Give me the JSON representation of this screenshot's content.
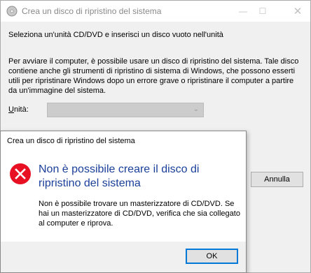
{
  "main_window": {
    "title": "Crea un disco di ripristino del sistema",
    "instruction": "Seleziona un'unità CD/DVD e inserisci un disco vuoto nell'unità",
    "description": "Per avviare il computer, è possibile usare un disco di ripristino del sistema. Tale disco contiene anche gli strumenti di ripristino di sistema di Windows, che possono esserti utili per ripristinare Windows dopo un errore grave o ripristinare il computer a partire da un'immagine del sistema.",
    "drive_label_u": "U",
    "drive_label_rest": "nità:",
    "drive_value": "",
    "cancel_label": "Annulla",
    "minimize_icon": "minimize-icon",
    "maximize_icon": "maximize-icon",
    "close_icon": "close-icon"
  },
  "error_dialog": {
    "title": "Crea un disco di ripristino del sistema",
    "heading": "Non è possibile creare il disco di ripristino del sistema",
    "message": "Non è possibile trovare un masterizzatore di CD/DVD. Se hai un masterizzatore di CD/DVD, verifica che sia collegato al computer e riprova.",
    "ok_label": "OK",
    "icon": "error-icon",
    "icon_color": "#e81123",
    "heading_color": "#1a3f99"
  }
}
